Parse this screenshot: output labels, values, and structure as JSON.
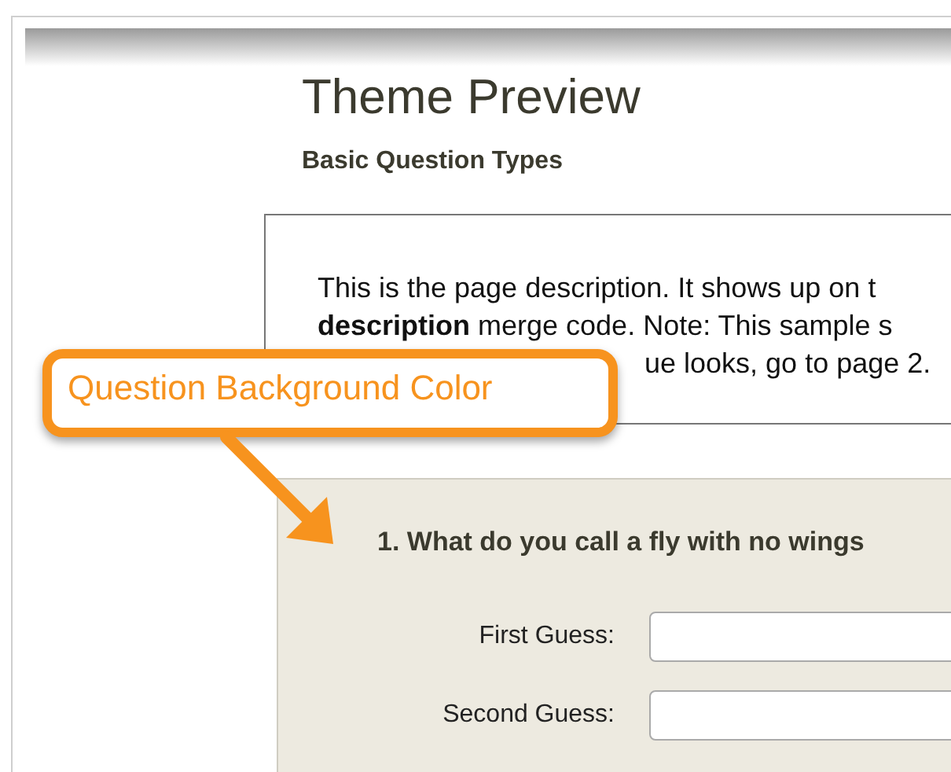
{
  "page": {
    "title": "Theme Preview",
    "subtitle": "Basic Question Types"
  },
  "description": {
    "lines": [
      "This is the page description. It shows up on t",
      "**description** merge code. Note: This sample s",
      "ue looks, go to page 2."
    ]
  },
  "question": {
    "text": "1. What do you call a fly with no wings",
    "fields": [
      {
        "label": "First Guess:"
      },
      {
        "label": "Second Guess:"
      }
    ]
  },
  "callout": {
    "text": "Question Background Color"
  }
}
